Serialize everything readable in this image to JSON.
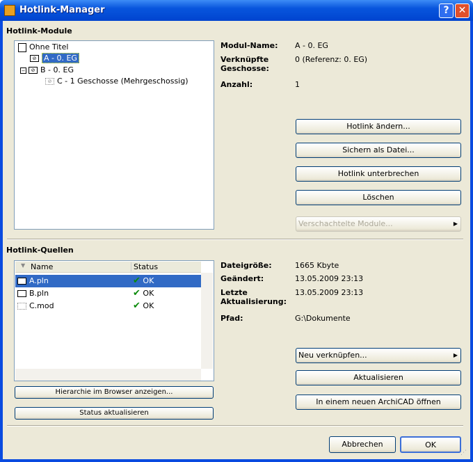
{
  "window": {
    "title": "Hotlink-Manager",
    "help": "?",
    "close": "✕"
  },
  "modules": {
    "heading": "Hotlink-Module",
    "tree": [
      {
        "label": "Ohne Titel"
      },
      {
        "label": "A - 0. EG"
      },
      {
        "label": "B - 0. EG"
      },
      {
        "label": "C - 1 Geschosse (Mehrgeschossig)"
      }
    ],
    "info": {
      "name_label": "Modul-Name:",
      "name_value": "A - 0. EG",
      "stories_label1": "Verknüpfte",
      "stories_label2": "Geschosse:",
      "stories_value": "0 (Referenz: 0. EG)",
      "count_label": "Anzahl:",
      "count_value": "1"
    },
    "buttons": {
      "change": "Hotlink ändern...",
      "save": "Sichern als Datei...",
      "break": "Hotlink unterbrechen",
      "delete": "Löschen",
      "nested": "Verschachtelte Module..."
    }
  },
  "sources": {
    "heading": "Hotlink-Quellen",
    "columns": {
      "name": "Name",
      "status": "Status"
    },
    "rows": [
      {
        "name": "A.pln",
        "status": "OK"
      },
      {
        "name": "B.pln",
        "status": "OK"
      },
      {
        "name": "C.mod",
        "status": "OK"
      }
    ],
    "info": {
      "size_label": "Dateigröße:",
      "size_value": "1665 Kbyte",
      "changed_label": "Geändert:",
      "changed_value": "13.05.2009 23:13",
      "updated_label1": "Letzte",
      "updated_label2": "Aktualisierung:",
      "updated_value": "13.05.2009 23:13",
      "path_label": "Pfad:",
      "path_value": "G:\\Dokumente"
    },
    "buttons": {
      "show_hierarchy": "Hierarchie im Browser anzeigen...",
      "refresh_status": "Status aktualisieren",
      "relink": "Neu verknüpfen...",
      "update": "Aktualisieren",
      "open_new": "In einem neuen ArchiCAD öffnen"
    }
  },
  "footer": {
    "cancel": "Abbrechen",
    "ok": "OK"
  }
}
